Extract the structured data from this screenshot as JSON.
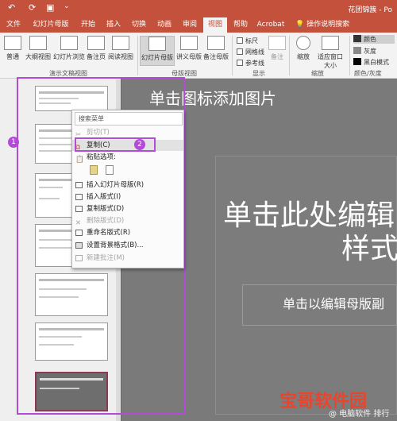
{
  "titlebar": {
    "doc_title": "花团锦簇 - Po",
    "qa_icons": [
      "undo-icon",
      "refresh-icon",
      "presentation-icon",
      "dropdown-icon"
    ]
  },
  "tabs": [
    "文件",
    "幻灯片母版",
    "开始",
    "插入",
    "切换",
    "动画",
    "审阅",
    "视图",
    "帮助",
    "Acrobat"
  ],
  "tell_me": "操作说明搜索",
  "ribbon": {
    "presentation_views": [
      "普通",
      "大纲视图",
      "幻灯片浏览",
      "备注页",
      "阅读视图"
    ],
    "group_pres": "演示文稿视图",
    "master_views": [
      "幻灯片母版",
      "讲义母版",
      "备注母版"
    ],
    "group_master": "母版视图",
    "show_checks": [
      "标尺",
      "网格线",
      "参考线"
    ],
    "notes": "备注",
    "group_show": "显示",
    "zoom": "缩放",
    "fit": "适应窗口大小",
    "group_zoom": "缩放",
    "color_options": [
      "颜色",
      "灰度",
      "黑白模式"
    ],
    "group_color": "颜色/灰度"
  },
  "slide": {
    "add_picture": "单击图标添加图片",
    "title_line1": "单击此处编辑",
    "title_line2": "样式",
    "subtitle": "单击以编辑母版副"
  },
  "menu": {
    "search": "搜索菜单",
    "items": [
      {
        "label": "剪切(T)",
        "disabled": true
      },
      {
        "label": "复制(C)",
        "disabled": false
      },
      {
        "label": "粘贴选项:",
        "disabled": false
      },
      {
        "label": "插入幻灯片母版(R)",
        "disabled": false
      },
      {
        "label": "插入版式(I)",
        "disabled": false
      },
      {
        "label": "复制版式(D)",
        "disabled": false
      },
      {
        "label": "删除版式(D)",
        "disabled": true
      },
      {
        "label": "重命名版式(R)",
        "disabled": false
      },
      {
        "label": "设置背景格式(B)...",
        "disabled": false
      },
      {
        "label": "新建批注(M)",
        "disabled": true
      }
    ]
  },
  "badges": [
    "1",
    "2"
  ],
  "watermark": {
    "main": "宝哥软件园",
    "sub": "@ 电脑软件 排行"
  },
  "colors": {
    "accent": "#c4513b",
    "highlight": "#b24bd6"
  }
}
